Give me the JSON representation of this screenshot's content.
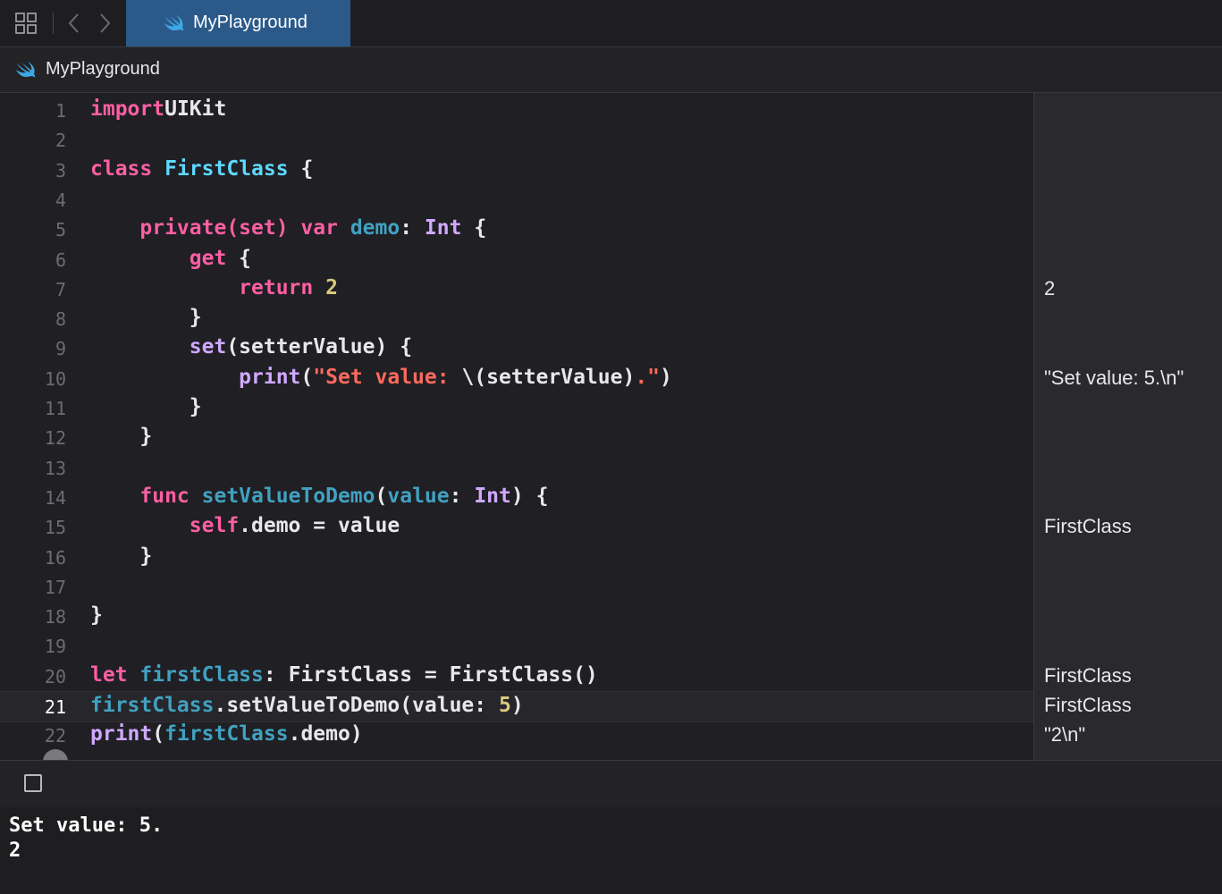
{
  "tab": {
    "title": "MyPlayground",
    "icon": "swift-icon"
  },
  "breadcrumb": {
    "label": "MyPlayground",
    "icon": "swift-icon"
  },
  "toolbar_icons": [
    "grid-icon",
    "chevron-left-icon",
    "chevron-right-icon"
  ],
  "editor": {
    "current_line": 21,
    "lines": [
      {
        "n": "1",
        "tokens": [
          [
            "kw",
            "import"
          ],
          [
            "",
            "UIKit"
          ]
        ],
        "indent": ""
      },
      {
        "n": "2",
        "tokens": []
      },
      {
        "n": "3",
        "tokens": [
          [
            "kw",
            "class"
          ],
          [
            "",
            " "
          ],
          [
            "ty",
            "FirstClass"
          ],
          [
            "",
            " {"
          ]
        ]
      },
      {
        "n": "4",
        "tokens": []
      },
      {
        "n": "5",
        "tokens": [
          [
            "",
            "    "
          ],
          [
            "kw",
            "private(set)"
          ],
          [
            "",
            " "
          ],
          [
            "kw",
            "var"
          ],
          [
            "",
            " "
          ],
          [
            "prop",
            "demo"
          ],
          [
            "",
            ": "
          ],
          [
            "sys",
            "Int"
          ],
          [
            "",
            " {"
          ]
        ]
      },
      {
        "n": "6",
        "tokens": [
          [
            "",
            "        "
          ],
          [
            "kw",
            "get"
          ],
          [
            "",
            " {"
          ]
        ]
      },
      {
        "n": "7",
        "tokens": [
          [
            "",
            "            "
          ],
          [
            "kw",
            "return"
          ],
          [
            "",
            " "
          ],
          [
            "num",
            "2"
          ]
        ]
      },
      {
        "n": "8",
        "tokens": [
          [
            "",
            "        }"
          ]
        ]
      },
      {
        "n": "9",
        "tokens": [
          [
            "",
            "        "
          ],
          [
            "sys",
            "set"
          ],
          [
            "",
            "(setterValue) {"
          ]
        ]
      },
      {
        "n": "10",
        "tokens": [
          [
            "",
            "            "
          ],
          [
            "sys",
            "print"
          ],
          [
            "",
            "("
          ],
          [
            "str",
            "\"Set value: "
          ],
          [
            "",
            "\\(setterValue)"
          ],
          [
            "str",
            ".\""
          ],
          [
            "",
            ")"
          ]
        ]
      },
      {
        "n": "11",
        "tokens": [
          [
            "",
            "        }"
          ]
        ]
      },
      {
        "n": "12",
        "tokens": [
          [
            "",
            "    }"
          ]
        ]
      },
      {
        "n": "13",
        "tokens": []
      },
      {
        "n": "14",
        "tokens": [
          [
            "",
            "    "
          ],
          [
            "kw",
            "func"
          ],
          [
            "",
            " "
          ],
          [
            "fn",
            "setValueToDemo"
          ],
          [
            "",
            "("
          ],
          [
            "prop",
            "value"
          ],
          [
            "",
            ": "
          ],
          [
            "sys",
            "Int"
          ],
          [
            "",
            ") {"
          ]
        ]
      },
      {
        "n": "15",
        "tokens": [
          [
            "",
            "        "
          ],
          [
            "kw",
            "self"
          ],
          [
            "",
            ".demo = value"
          ]
        ]
      },
      {
        "n": "16",
        "tokens": [
          [
            "",
            "    }"
          ]
        ]
      },
      {
        "n": "17",
        "tokens": []
      },
      {
        "n": "18",
        "tokens": [
          [
            "",
            "}"
          ]
        ]
      },
      {
        "n": "19",
        "tokens": []
      },
      {
        "n": "20",
        "tokens": [
          [
            "kw",
            "let"
          ],
          [
            "",
            " "
          ],
          [
            "prop",
            "firstClass"
          ],
          [
            "",
            ": FirstClass = FirstClass()"
          ]
        ]
      },
      {
        "n": "21",
        "tokens": [
          [
            "prop",
            "firstClass"
          ],
          [
            "",
            ".setValueToDemo(value: "
          ],
          [
            "num",
            "5"
          ],
          [
            "",
            ")"
          ]
        ]
      },
      {
        "n": "22",
        "tokens": [
          [
            "sys",
            "print"
          ],
          [
            "",
            "("
          ],
          [
            "prop",
            "firstClass"
          ],
          [
            "",
            ".demo)"
          ]
        ]
      }
    ]
  },
  "results": [
    {
      "line": 7,
      "text": "2"
    },
    {
      "line": 10,
      "text": "\"Set value: 5.\\n\""
    },
    {
      "line": 15,
      "text": "FirstClass"
    },
    {
      "line": 20,
      "text": "FirstClass"
    },
    {
      "line": 21,
      "text": "FirstClass"
    },
    {
      "line": 22,
      "text": "\"2\\n\""
    }
  ],
  "console": {
    "lines": [
      "Set value: 5.",
      "2"
    ]
  }
}
